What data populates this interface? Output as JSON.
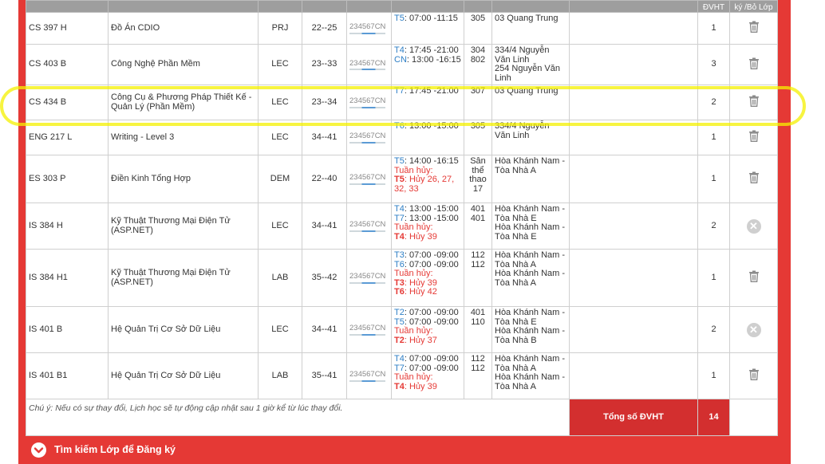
{
  "header": {
    "cols": [
      "",
      "",
      "",
      "",
      "",
      "",
      "",
      "",
      "",
      "ĐVHT",
      "ký /Bỏ Lớp"
    ]
  },
  "rows": [
    {
      "code": "CS 397 H",
      "name": "Đồ Án CDIO",
      "type": "PRJ",
      "range": "22--25",
      "week": "234567CN",
      "times": [
        {
          "day": "T5",
          "text": ": 07:00 -11:15"
        }
      ],
      "rooms": [
        "305"
      ],
      "locs": [
        "03 Quang Trung"
      ],
      "cred": "1",
      "action": "trash"
    },
    {
      "code": "CS 403 B",
      "name": "Công Nghệ Phần Mềm",
      "type": "LEC",
      "range": "23--33",
      "week": "234567CN",
      "times": [
        {
          "day": "T4",
          "text": ": 17:45 -21:00"
        },
        {
          "day": "CN",
          "text": ": 13:00 -16:15"
        }
      ],
      "rooms": [
        "304",
        "802"
      ],
      "locs": [
        "334/4 Nguyễn Văn Linh",
        "254 Nguyễn Văn Linh"
      ],
      "cred": "3",
      "action": "trash"
    },
    {
      "code": "CS 434 B",
      "name": "Công Cụ & Phương Pháp Thiết Kế - Quản Lý (Phần Mềm)",
      "type": "LEC",
      "range": "23--34",
      "week": "234567CN",
      "times": [
        {
          "day": "T7",
          "text": ": 17:45 -21:00"
        }
      ],
      "rooms": [
        "307"
      ],
      "locs": [
        "03 Quang Trung"
      ],
      "cred": "2",
      "action": "trash"
    },
    {
      "code": "ENG 217 L",
      "name": "Writing - Level 3",
      "type": "LEC",
      "range": "34--41",
      "week": "234567CN",
      "times": [
        {
          "day": "T6",
          "text": ": 13:00 -15:00"
        }
      ],
      "rooms": [
        "305"
      ],
      "locs": [
        "334/4 Nguyễn Văn Linh"
      ],
      "cred": "1",
      "action": "trash"
    },
    {
      "code": "ES 303 P",
      "name": "Điền Kinh Tổng Hợp",
      "type": "DEM",
      "range": "22--40",
      "week": "234567CN",
      "times": [
        {
          "day": "T5",
          "text": ": 14:00 -16:15"
        }
      ],
      "cancel": {
        "label": "Tuần hủy:",
        "lines": [
          {
            "day": "T5",
            "text": ": Hủy 26, 27, 32, 33"
          }
        ]
      },
      "rooms": [
        "Sân thể thao 17"
      ],
      "locs": [
        "Hòa Khánh Nam - Tòa Nhà A"
      ],
      "cred": "1",
      "action": "trash"
    },
    {
      "code": "IS 384 H",
      "name": "Kỹ Thuật Thương Mại Điện Tử (ASP.NET)",
      "type": "LEC",
      "range": "34--41",
      "week": "234567CN",
      "times": [
        {
          "day": "T4",
          "text": ": 13:00 -15:00"
        },
        {
          "day": "T7",
          "text": ": 13:00 -15:00"
        }
      ],
      "cancel": {
        "label": "Tuần hủy:",
        "lines": [
          {
            "day": "T4",
            "text": ": Hủy 39"
          }
        ]
      },
      "rooms": [
        "401",
        "401"
      ],
      "locs": [
        "Hòa Khánh Nam - Tòa Nhà E",
        "Hòa Khánh Nam - Tòa Nhà E"
      ],
      "cred": "2",
      "action": "x"
    },
    {
      "code": "IS 384 H1",
      "name": "Kỹ Thuật Thương Mại Điện Tử (ASP.NET)",
      "type": "LAB",
      "range": "35--42",
      "week": "234567CN",
      "times": [
        {
          "day": "T3",
          "text": ": 07:00 -09:00"
        },
        {
          "day": "T6",
          "text": ": 07:00 -09:00"
        }
      ],
      "cancel": {
        "label": "Tuần hủy:",
        "lines": [
          {
            "day": "T3",
            "text": ": Hủy 39"
          },
          {
            "day": "T6",
            "text": ": Hủy 42"
          }
        ]
      },
      "rooms": [
        "112",
        "112"
      ],
      "locs": [
        "Hòa Khánh Nam - Tòa Nhà A",
        "Hòa Khánh Nam - Tòa Nhà A"
      ],
      "cred": "1",
      "action": "trash"
    },
    {
      "code": "IS 401 B",
      "name": "Hệ Quản Trị Cơ Sở Dữ Liệu",
      "type": "LEC",
      "range": "34--41",
      "week": "234567CN",
      "times": [
        {
          "day": "T2",
          "text": ": 07:00 -09:00"
        },
        {
          "day": "T5",
          "text": ": 07:00 -09:00"
        }
      ],
      "cancel": {
        "label": "Tuần hủy:",
        "lines": [
          {
            "day": "T2",
            "text": ": Hủy 37"
          }
        ]
      },
      "rooms": [
        "401",
        "110"
      ],
      "locs": [
        "Hòa Khánh Nam - Tòa Nhà E",
        "Hòa Khánh Nam - Tòa Nhà B"
      ],
      "cred": "2",
      "action": "x"
    },
    {
      "code": "IS 401 B1",
      "name": "Hệ Quản Trị Cơ Sở Dữ Liệu",
      "type": "LAB",
      "range": "35--41",
      "week": "234567CN",
      "times": [
        {
          "day": "T4",
          "text": ": 07:00 -09:00"
        },
        {
          "day": "T7",
          "text": ": 07:00 -09:00"
        }
      ],
      "cancel": {
        "label": "Tuần hủy:",
        "lines": [
          {
            "day": "T4",
            "text": ": Hủy 39"
          }
        ]
      },
      "rooms": [
        "112",
        "112"
      ],
      "locs": [
        "Hòa Khánh Nam - Tòa Nhà A",
        "Hòa Khánh Nam - Tòa Nhà A"
      ],
      "cred": "1",
      "action": "trash"
    }
  ],
  "footer": {
    "note": "Chú ý: Nếu có sự thay đổi, Lịch học sẽ tự động cập nhật sau 1 giờ kể từ lúc thay đổi.",
    "total_label": "Tổng số ĐVHT",
    "total_value": "14"
  },
  "search": {
    "label": "Tìm kiếm Lớp để Đăng ký"
  },
  "colors": {
    "accent": "#e53935",
    "day": "#2e7fc6",
    "highlight": "#f4f000"
  },
  "icons": {
    "delete": "trash-icon",
    "unavailable": "x-circle-icon",
    "expand": "chevron-down-icon"
  }
}
